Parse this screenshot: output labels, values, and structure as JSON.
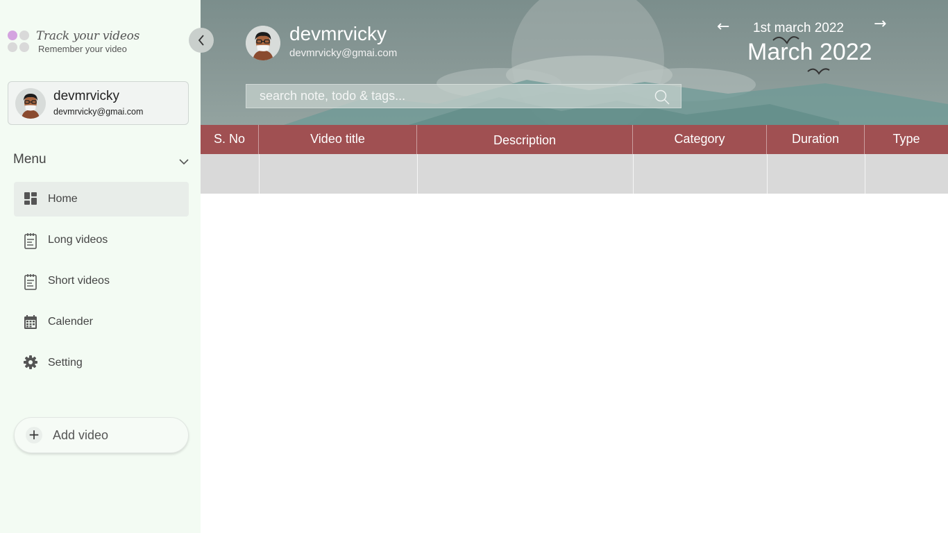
{
  "app": {
    "logo_title": "Track your videos",
    "logo_subtitle": "Remember your video"
  },
  "user": {
    "name": "devmrvicky",
    "email": "devmrvicky@gmai.com"
  },
  "menu": {
    "label": "Menu",
    "items": [
      {
        "label": "Home",
        "icon": "dashboard-icon",
        "active": true
      },
      {
        "label": "Long videos",
        "icon": "notepad-icon",
        "active": false
      },
      {
        "label": "Short videos",
        "icon": "notepad-icon",
        "active": false
      },
      {
        "label": "Calender",
        "icon": "calendar-icon",
        "active": false
      },
      {
        "label": "Setting",
        "icon": "gear-icon",
        "active": false
      }
    ]
  },
  "add_video": {
    "label": "Add video",
    "icon": "plus-icon"
  },
  "header": {
    "date_day": "1st march 2022",
    "date_month": "March 2022",
    "prev_arrow": "←",
    "next_arrow": "→"
  },
  "search": {
    "placeholder": "search note, todo & tags..."
  },
  "table": {
    "columns": [
      "S. No",
      "Video title",
      "Description",
      "Category",
      "Duration",
      "Type"
    ],
    "rows": [
      [
        "",
        "",
        "",
        "",
        "",
        ""
      ]
    ]
  },
  "colors": {
    "sidebar_bg": "#f3fbf3",
    "table_header": "#a05052",
    "table_row": "#d9d9d9",
    "logo_accent": "#d4a3e0"
  }
}
